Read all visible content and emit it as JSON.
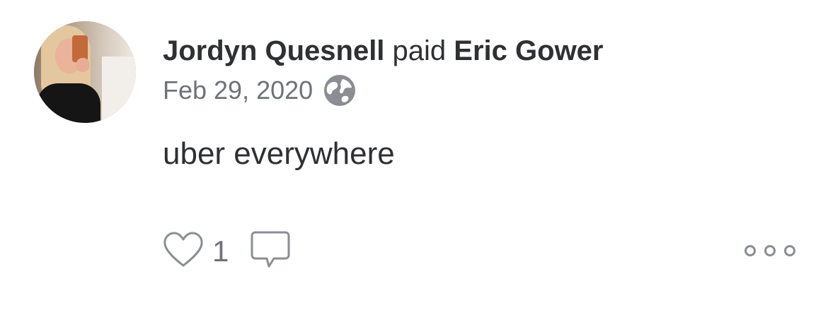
{
  "story": {
    "sender_name": "Jordyn Quesnell",
    "action_verb": "paid",
    "recipient_name": "Eric Gower",
    "date": "Feb 29, 2020",
    "privacy_icon": "globe-icon",
    "message": "uber everywhere"
  },
  "actions": {
    "like_icon": "heart-icon",
    "like_count": "1",
    "comment_icon": "comment-icon",
    "more_icon": "more-options-icon"
  },
  "colors": {
    "text_primary": "#2f3033",
    "text_secondary": "#6f7378",
    "icon_gray": "#8a8e93"
  }
}
